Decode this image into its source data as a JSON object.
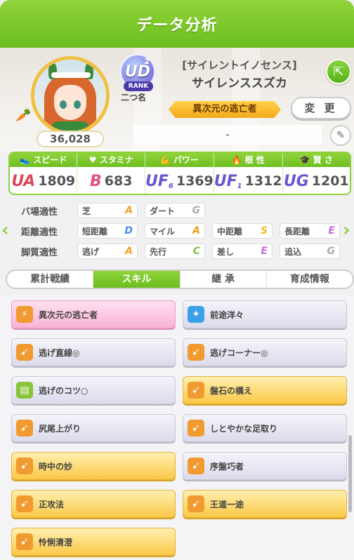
{
  "header": {
    "title": "データ分析"
  },
  "profile": {
    "fans": "36,028",
    "rank": {
      "label": "RANK",
      "code": "UD",
      "sup": "2"
    },
    "nickname_label": "二つ名",
    "title": "[サイレントイノセンス]",
    "name": "サイレンススズカ",
    "epithet": "異次元の逃亡者",
    "change_label": "変 更",
    "comment": "-"
  },
  "stats": [
    {
      "label": "スピード",
      "icon": "shoe-icon",
      "grade": "UA",
      "value": "1809",
      "color": "#d94a5c"
    },
    {
      "label": "スタミナ",
      "icon": "heart-icon",
      "grade": "B",
      "value": "683",
      "color": "#e2508a"
    },
    {
      "label": "パワー",
      "icon": "muscle-icon",
      "grade": "UF",
      "grade_sup": "6",
      "value": "1369",
      "color": "#6a55d0"
    },
    {
      "label": "根 性",
      "icon": "flame-icon",
      "grade": "UF",
      "grade_sup": "1",
      "value": "1312",
      "color": "#6a55d0"
    },
    {
      "label": "賢 さ",
      "icon": "grad-cap-icon",
      "grade": "UG",
      "value": "1201",
      "color": "#6a55d0"
    }
  ],
  "aptitude": {
    "rows": [
      {
        "label": "バ場適性",
        "cells": [
          {
            "name": "芝",
            "grade": "A"
          },
          {
            "name": "ダート",
            "grade": "G"
          }
        ]
      },
      {
        "label": "距離適性",
        "cells": [
          {
            "name": "短距離",
            "grade": "D"
          },
          {
            "name": "マイル",
            "grade": "A"
          },
          {
            "name": "中距離",
            "grade": "S"
          },
          {
            "name": "長距離",
            "grade": "E"
          }
        ]
      },
      {
        "label": "脚質適性",
        "cells": [
          {
            "name": "逃げ",
            "grade": "A"
          },
          {
            "name": "先行",
            "grade": "C"
          },
          {
            "name": "差し",
            "grade": "E"
          },
          {
            "name": "追込",
            "grade": "G"
          }
        ]
      }
    ],
    "grade_colors": {
      "A": "#f0a020",
      "S": "#e8c020",
      "C": "#7ac43a",
      "D": "#4a8fe0",
      "E": "#c070e0",
      "G": "#aaaaaa"
    }
  },
  "tabs": [
    {
      "label": "累計戦績",
      "active": false
    },
    {
      "label": "スキル",
      "active": true
    },
    {
      "label": "継 承",
      "active": false
    },
    {
      "label": "育成情報",
      "active": false
    }
  ],
  "skills": [
    {
      "name": "異次元の逃亡者",
      "style": "unique",
      "icon": "unique-skill-icon",
      "icon_color": "#f09a30"
    },
    {
      "name": "前途洋々",
      "style": "normal",
      "icon": "sparkle-icon",
      "icon_color": "#3aa0e8"
    },
    {
      "name": "逃げ直線◎",
      "style": "normal",
      "icon": "speed-up-icon",
      "icon_color": "#f09a30"
    },
    {
      "name": "逃げコーナー◎",
      "style": "normal",
      "icon": "speed-up-icon",
      "icon_color": "#f09a30"
    },
    {
      "name": "逃げのコツ○",
      "style": "normal",
      "icon": "book-icon",
      "icon_color": "#8ac43a"
    },
    {
      "name": "盤石の構え",
      "style": "gold",
      "icon": "speed-up-icon",
      "icon_color": "#f09a30"
    },
    {
      "name": "尻尾上がり",
      "style": "normal",
      "icon": "speed-up-icon",
      "icon_color": "#f09a30"
    },
    {
      "name": "しとやかな足取り",
      "style": "normal",
      "icon": "speed-up-icon",
      "icon_color": "#f09a30"
    },
    {
      "name": "時中の妙",
      "style": "gold",
      "icon": "speed-up-icon",
      "icon_color": "#f09a30"
    },
    {
      "name": "序盤巧者",
      "style": "normal",
      "icon": "speed-up-icon",
      "icon_color": "#f09a30"
    },
    {
      "name": "正攻法",
      "style": "gold",
      "icon": "speed-up-icon",
      "icon_color": "#f09a30"
    },
    {
      "name": "王道一途",
      "style": "gold",
      "icon": "speed-up-icon",
      "icon_color": "#f09a30"
    },
    {
      "name": "怜悧清澄",
      "style": "gold",
      "icon": "speed-up-icon",
      "icon_color": "#f09a30"
    }
  ]
}
